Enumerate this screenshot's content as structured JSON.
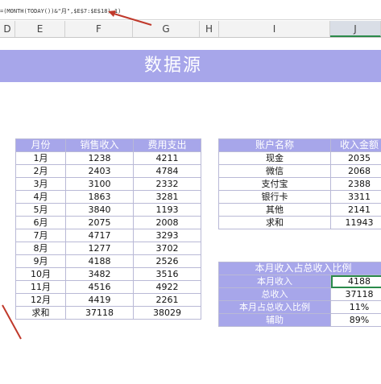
{
  "formula_bar": {
    "text": "=(MONTH(TODAY())&\"月\",$E$7:$E$18),1)"
  },
  "columns": [
    "D",
    "E",
    "F",
    "G",
    "H",
    "I",
    "J"
  ],
  "title": "数据源",
  "monthly_table": {
    "headers": [
      "月份",
      "销售收入",
      "费用支出"
    ],
    "rows": [
      [
        "1月",
        "1238",
        "4211"
      ],
      [
        "2月",
        "2403",
        "4784"
      ],
      [
        "3月",
        "3100",
        "2332"
      ],
      [
        "4月",
        "1863",
        "3281"
      ],
      [
        "5月",
        "3840",
        "1193"
      ],
      [
        "6月",
        "2075",
        "2008"
      ],
      [
        "7月",
        "4717",
        "3293"
      ],
      [
        "8月",
        "1277",
        "3702"
      ],
      [
        "9月",
        "4188",
        "2526"
      ],
      [
        "10月",
        "3482",
        "3516"
      ],
      [
        "11月",
        "4516",
        "4922"
      ],
      [
        "12月",
        "4419",
        "2261"
      ],
      [
        "求和",
        "37118",
        "38029"
      ]
    ]
  },
  "account_table": {
    "headers": [
      "账户名称",
      "收入金额"
    ],
    "rows": [
      [
        "现金",
        "2035"
      ],
      [
        "微信",
        "2068"
      ],
      [
        "支付宝",
        "2388"
      ],
      [
        "银行卡",
        "3311"
      ],
      [
        "其他",
        "2141"
      ],
      [
        "求和",
        "11943"
      ]
    ]
  },
  "ratio_table": {
    "title": "本月收入占总收入比例",
    "rows": [
      [
        "本月收入",
        "4188"
      ],
      [
        "总收入",
        "37118"
      ],
      [
        "本月占总收入比例",
        "11%"
      ],
      [
        "辅助",
        "89%"
      ]
    ]
  },
  "colors": {
    "header_fill": "#a7a6ea",
    "border": "#b9b9d6",
    "selection": "#2a8a4a",
    "arrow": "#c0392b"
  }
}
